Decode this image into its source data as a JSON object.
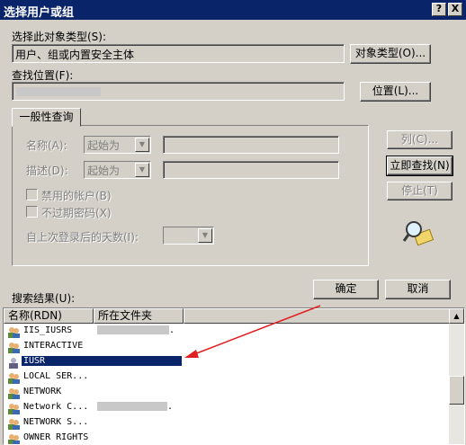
{
  "window": {
    "title": "选择用户或组",
    "help_label": "?",
    "close_label": "X"
  },
  "object_type": {
    "label": "选择此对象类型(S):",
    "value": "用户、组或内置安全主体",
    "button": "对象类型(O)..."
  },
  "location": {
    "label": "查找位置(F):",
    "button": "位置(L)..."
  },
  "query": {
    "tab": "一般性查询",
    "name_label": "名称(A):",
    "name_mode": "起始为",
    "desc_label": "描述(D):",
    "desc_mode": "起始为",
    "disabled_accounts": "禁用的帐户(B)",
    "non_expiring": "不过期密码(X)",
    "days_label": "自上次登录后的天数(I):",
    "columns_button": "列(C)...",
    "find_now_button": "立即查找(N)",
    "stop_button": "停止(T)"
  },
  "results": {
    "label": "搜索结果(U):",
    "ok_button": "确定",
    "cancel_button": "取消",
    "columns": [
      "名称(RDN)",
      "所在文件夹"
    ],
    "rows": [
      {
        "name": "IIS_IUSRS",
        "folder": "."
      },
      {
        "name": "INTERACTIVE",
        "folder": ""
      },
      {
        "name": "IUSR",
        "folder": ""
      },
      {
        "name": "LOCAL SER...",
        "folder": ""
      },
      {
        "name": "NETWORK",
        "folder": ""
      },
      {
        "name": "Network C...",
        "folder": "."
      },
      {
        "name": "NETWORK S...",
        "folder": ""
      },
      {
        "name": "OWNER RIGHTS",
        "folder": ""
      }
    ],
    "selected_row": "IUSR"
  },
  "colors": {
    "title_bar": "#0a246a",
    "selection": "#0a246a",
    "annotation_arrow": "#e02020"
  }
}
